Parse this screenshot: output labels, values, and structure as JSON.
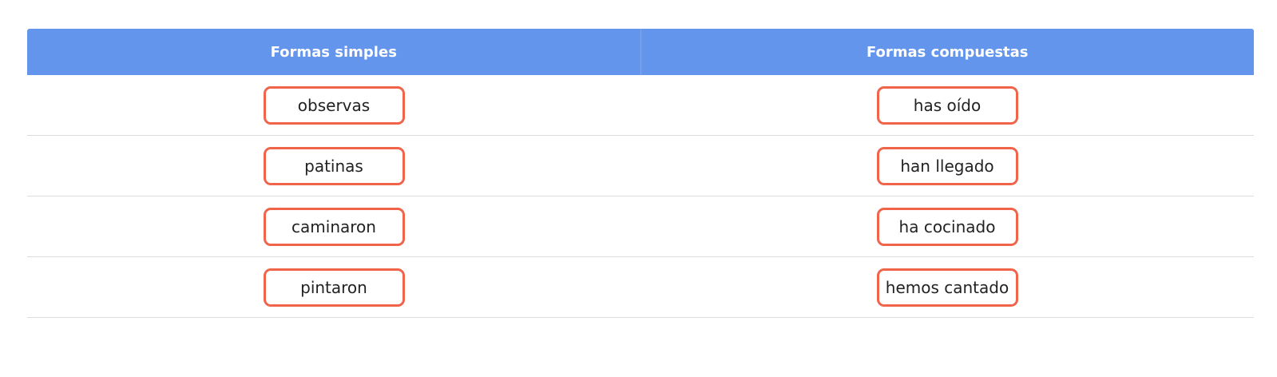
{
  "table": {
    "headers": [
      "Formas simples",
      "Formas compuestas"
    ],
    "accent_header_color": "#6495ed",
    "chip_border_color": "#f0654a",
    "rows": [
      [
        "observas",
        "has oído"
      ],
      [
        "patinas",
        "han llegado"
      ],
      [
        "caminaron",
        "ha cocinado"
      ],
      [
        "pintaron",
        "hemos cantado"
      ]
    ]
  }
}
